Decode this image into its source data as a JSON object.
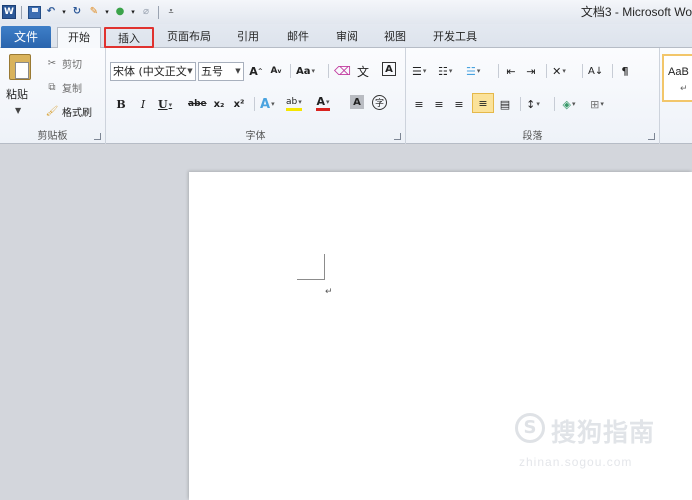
{
  "title_bar": {
    "title": "文档3 - Microsoft Wo",
    "qat_icons": [
      "word-logo-icon",
      "save-icon",
      "undo-icon",
      "redo-icon",
      "format-painter-icon",
      "color-icon",
      "clear-icon",
      "customize-icon"
    ],
    "word_logo_letter": "W"
  },
  "tabs": {
    "file": "文件",
    "items": [
      "开始",
      "插入",
      "页面布局",
      "引用",
      "邮件",
      "审阅",
      "视图",
      "开发工具"
    ],
    "active": "开始",
    "highlighted": "插入"
  },
  "clipboard": {
    "paste": "粘贴",
    "cut": "剪切",
    "copy": "复制",
    "format_painter": "格式刷",
    "label": "剪贴板"
  },
  "font": {
    "font_name": "宋体 (中文正文",
    "font_size": "五号",
    "grow": "A",
    "shrink": "A",
    "change_case": "Aa",
    "bold": "B",
    "italic": "I",
    "underline": "U",
    "strike": "abe",
    "subscript": "x₂",
    "superscript": "x²",
    "label": "字体",
    "phonetic": "文",
    "char_border": "A",
    "char_shading": "A",
    "enclose": "字",
    "text_effect": "A",
    "highlight": "ab",
    "font_color": "A",
    "clear_format": "A"
  },
  "paragraph": {
    "label": "段落"
  },
  "styles": {
    "preview": "AaB",
    "sub": "↵"
  },
  "document": {
    "paragraph_mark": "↵"
  },
  "watermark": {
    "circle": "S",
    "name": "搜狗指南",
    "url": "zhinan.sogou.com"
  },
  "colors": {
    "file_tab": "#2a64ad",
    "highlight_border": "#e0322f",
    "workspace": "#d3d6dc"
  }
}
